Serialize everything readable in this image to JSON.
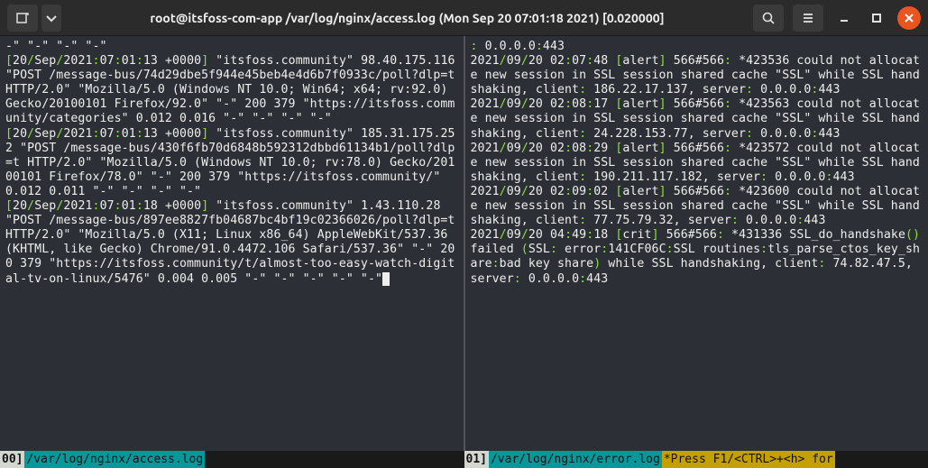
{
  "title": "root@itsfoss-com-app /var/log/nginx/access.log (Mon Sep 20 07:01:18 2021) [0.020000]",
  "statusbar": {
    "left_index": "00]",
    "left_path": " /var/log/nginx/access.log",
    "right_index": "01]",
    "right_path": " /var/log/nginx/error.log",
    "right_hint": " *Press F1/<CTRL>+<h> for "
  },
  "left_lines": [
    [
      [
        "wh",
        "-\" \"-\" \"-\" \"-\""
      ]
    ],
    [
      [
        "gr",
        "["
      ],
      [
        "wh",
        "20"
      ],
      [
        "gr",
        "/"
      ],
      [
        "wh",
        "Sep"
      ],
      [
        "gr",
        "/"
      ],
      [
        "wh",
        "2021"
      ],
      [
        "gr",
        ":"
      ],
      [
        "wh",
        "07"
      ],
      [
        "gr",
        ":"
      ],
      [
        "wh",
        "01"
      ],
      [
        "gr",
        ":"
      ],
      [
        "wh",
        "13 +0000"
      ],
      [
        "gr",
        "]"
      ],
      [
        "wh",
        " \"itsfoss.community\" 98.40.175.116 \"POST /message-bus/74d29dbe5f944e45beb4e4d6b7f0933c/poll?dlp=t HTTP/2.0\" \"Mozilla/5.0 (Windows NT 10.0; Win64; x64; rv:92.0) Gecko/20100101 Firefox/92.0\" \"-\" 200 379 \"https://itsfoss.community/categories\" 0.012 0.016 \"-\" \"-\" \"-\" \"-\""
      ]
    ],
    [
      [
        "gr",
        "["
      ],
      [
        "wh",
        "20"
      ],
      [
        "gr",
        "/"
      ],
      [
        "wh",
        "Sep"
      ],
      [
        "gr",
        "/"
      ],
      [
        "wh",
        "2021"
      ],
      [
        "gr",
        ":"
      ],
      [
        "wh",
        "07"
      ],
      [
        "gr",
        ":"
      ],
      [
        "wh",
        "01"
      ],
      [
        "gr",
        ":"
      ],
      [
        "wh",
        "13 +0000"
      ],
      [
        "gr",
        "]"
      ],
      [
        "wh",
        " \"itsfoss.community\" 185.31.175.252 \"POST /message-bus/430f6fb70d6848b592312dbbd61134b1/poll?dlp=t HTTP/2.0\" \"Mozilla/5.0 (Windows NT 10.0; rv:78.0) Gecko/20100101 Firefox/78.0\" \"-\" 200 379 \"https://itsfoss.community/\" 0.012 0.011 \"-\" \"-\" \"-\" \"-\""
      ]
    ],
    [
      [
        "gr",
        "["
      ],
      [
        "wh",
        "20"
      ],
      [
        "gr",
        "/"
      ],
      [
        "wh",
        "Sep"
      ],
      [
        "gr",
        "/"
      ],
      [
        "wh",
        "2021"
      ],
      [
        "gr",
        ":"
      ],
      [
        "wh",
        "07"
      ],
      [
        "gr",
        ":"
      ],
      [
        "wh",
        "01"
      ],
      [
        "gr",
        ":"
      ],
      [
        "wh",
        "18 +0000"
      ],
      [
        "gr",
        "]"
      ],
      [
        "wh",
        " \"itsfoss.community\" 1.43.110.28 \"POST /message-bus/897ee8827fb04687bc4bf19c02366026/poll?dlp=t HTTP/2.0\" \"Mozilla/5.0 (X11; Linux x86_64) AppleWebKit/537.36 (KHTML, like Gecko) Chrome/91.0.4472.106 Safari/537.36\" \"-\" 200 379 \"https://itsfoss.community/t/almost-too-easy-watch-digital-tv-on-linux/5476\" 0.004 0.005 \"-\" \"-\" \"-\" \"-\" \"-\""
      ]
    ]
  ],
  "right_lines": [
    [
      [
        "gr",
        ":"
      ],
      [
        "wh",
        " 0.0.0.0"
      ],
      [
        "gr",
        ":"
      ],
      [
        "wh",
        "443"
      ]
    ],
    [
      [
        "wh",
        "2021"
      ],
      [
        "gr",
        "/"
      ],
      [
        "wh",
        "09"
      ],
      [
        "gr",
        "/"
      ],
      [
        "wh",
        "20 02"
      ],
      [
        "gr",
        ":"
      ],
      [
        "wh",
        "07"
      ],
      [
        "gr",
        ":"
      ],
      [
        "wh",
        "48 "
      ],
      [
        "gr",
        "["
      ],
      [
        "wh",
        "alert"
      ],
      [
        "gr",
        "]"
      ],
      [
        "wh",
        " 566#566"
      ],
      [
        "gr",
        ":"
      ],
      [
        "wh",
        " *423536 could not allocate new session in SSL session shared cache \"SSL\" while SSL handshaking, client"
      ],
      [
        "gr",
        ":"
      ],
      [
        "wh",
        " 186.22.17.137, server"
      ],
      [
        "gr",
        ":"
      ],
      [
        "wh",
        " 0.0.0.0"
      ],
      [
        "gr",
        ":"
      ],
      [
        "wh",
        "443"
      ]
    ],
    [
      [
        "wh",
        "2021"
      ],
      [
        "gr",
        "/"
      ],
      [
        "wh",
        "09"
      ],
      [
        "gr",
        "/"
      ],
      [
        "wh",
        "20 02"
      ],
      [
        "gr",
        ":"
      ],
      [
        "wh",
        "08"
      ],
      [
        "gr",
        ":"
      ],
      [
        "wh",
        "17 "
      ],
      [
        "gr",
        "["
      ],
      [
        "wh",
        "alert"
      ],
      [
        "gr",
        "]"
      ],
      [
        "wh",
        " 566#566"
      ],
      [
        "gr",
        ":"
      ],
      [
        "wh",
        " *423563 could not allocate new session in SSL session shared cache \"SSL\" while SSL handshaking, client"
      ],
      [
        "gr",
        ":"
      ],
      [
        "wh",
        " 24.228.153.77, server"
      ],
      [
        "gr",
        ":"
      ],
      [
        "wh",
        " 0.0.0.0"
      ],
      [
        "gr",
        ":"
      ],
      [
        "wh",
        "443"
      ]
    ],
    [
      [
        "wh",
        "2021"
      ],
      [
        "gr",
        "/"
      ],
      [
        "wh",
        "09"
      ],
      [
        "gr",
        "/"
      ],
      [
        "wh",
        "20 02"
      ],
      [
        "gr",
        ":"
      ],
      [
        "wh",
        "08"
      ],
      [
        "gr",
        ":"
      ],
      [
        "wh",
        "29 "
      ],
      [
        "gr",
        "["
      ],
      [
        "wh",
        "alert"
      ],
      [
        "gr",
        "]"
      ],
      [
        "wh",
        " 566#566"
      ],
      [
        "gr",
        ":"
      ],
      [
        "wh",
        " *423572 could not allocate new session in SSL session shared cache \"SSL\" while SSL handshaking, client"
      ],
      [
        "gr",
        ":"
      ],
      [
        "wh",
        " 190.211.117.182, server"
      ],
      [
        "gr",
        ":"
      ],
      [
        "wh",
        " 0.0.0.0"
      ],
      [
        "gr",
        ":"
      ],
      [
        "wh",
        "443"
      ]
    ],
    [
      [
        "wh",
        "2021"
      ],
      [
        "gr",
        "/"
      ],
      [
        "wh",
        "09"
      ],
      [
        "gr",
        "/"
      ],
      [
        "wh",
        "20 02"
      ],
      [
        "gr",
        ":"
      ],
      [
        "wh",
        "09"
      ],
      [
        "gr",
        ":"
      ],
      [
        "wh",
        "02 "
      ],
      [
        "gr",
        "["
      ],
      [
        "wh",
        "alert"
      ],
      [
        "gr",
        "]"
      ],
      [
        "wh",
        " 566#566"
      ],
      [
        "gr",
        ":"
      ],
      [
        "wh",
        " *423600 could not allocate new session in SSL session shared cache \"SSL\" while SSL handshaking, client"
      ],
      [
        "gr",
        ":"
      ],
      [
        "wh",
        " 77.75.79.32, server"
      ],
      [
        "gr",
        ":"
      ],
      [
        "wh",
        " 0.0.0.0"
      ],
      [
        "gr",
        ":"
      ],
      [
        "wh",
        "443"
      ]
    ],
    [
      [
        "wh",
        "2021"
      ],
      [
        "gr",
        "/"
      ],
      [
        "wh",
        "09"
      ],
      [
        "gr",
        "/"
      ],
      [
        "wh",
        "20 04"
      ],
      [
        "gr",
        ":"
      ],
      [
        "wh",
        "49"
      ],
      [
        "gr",
        ":"
      ],
      [
        "wh",
        "18 "
      ],
      [
        "gr",
        "["
      ],
      [
        "wh",
        "crit"
      ],
      [
        "gr",
        "]"
      ],
      [
        "wh",
        " 566#566"
      ],
      [
        "gr",
        ":"
      ],
      [
        "wh",
        " *431336 SSL_do_handshake"
      ],
      [
        "gr",
        "()"
      ],
      [
        "wh",
        " failed "
      ],
      [
        "gr",
        "("
      ],
      [
        "wh",
        "SSL"
      ],
      [
        "gr",
        ":"
      ],
      [
        "wh",
        " error"
      ],
      [
        "gr",
        ":"
      ],
      [
        "wh",
        "141CF06C"
      ],
      [
        "gr",
        ":"
      ],
      [
        "wh",
        "SSL routines"
      ],
      [
        "gr",
        ":"
      ],
      [
        "wh",
        "tls_parse_ctos_key_share"
      ],
      [
        "gr",
        ":"
      ],
      [
        "wh",
        "bad key share"
      ],
      [
        "gr",
        ")"
      ],
      [
        "wh",
        " while SSL handshaking, client"
      ],
      [
        "gr",
        ":"
      ],
      [
        "wh",
        " 74.82.47.5, server"
      ],
      [
        "gr",
        ":"
      ],
      [
        "wh",
        " 0.0.0.0"
      ],
      [
        "gr",
        ":"
      ],
      [
        "wh",
        "443"
      ]
    ]
  ]
}
